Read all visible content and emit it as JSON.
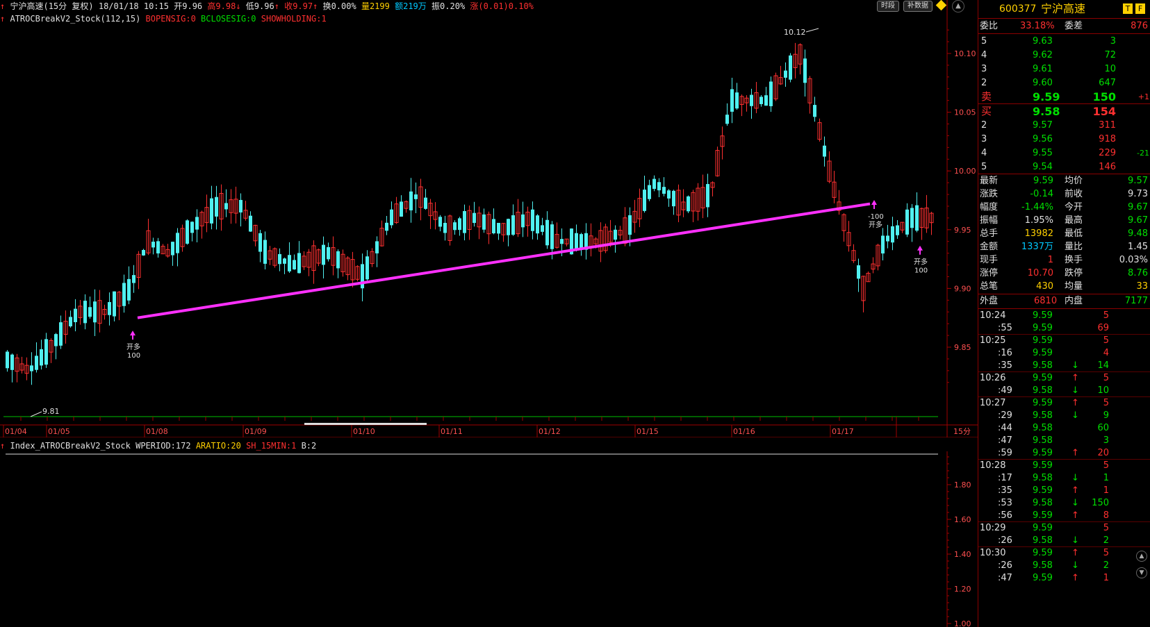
{
  "header": {
    "stock_name": "宁沪高速",
    "period": "(15分 复权)",
    "datetime": "18/01/18 10:15",
    "open_label": "开",
    "open": "9.96",
    "high_label": "高",
    "high": "9.98",
    "low_label": "低",
    "low": "9.96",
    "close_label": "收",
    "close": "9.97",
    "turnover_label": "换",
    "turnover": "0.00%",
    "vol_label": "量",
    "vol": "2199",
    "amount_label": "额",
    "amount": "219万",
    "amp_label": "振",
    "amp": "0.20%",
    "chg_label": "涨",
    "chg": "(0.01)0.10%",
    "btn_time": "时段",
    "btn_supplement": "补数据"
  },
  "indicator": {
    "name": "ATROCBreakV2_Stock(112,15)",
    "p1": "BOPENSIG:0",
    "p2": "BCLOSESIG:0",
    "p3": "SHOWHOLDING:1"
  },
  "sub_indicator": {
    "name": "Index_ATROCBreakV2_Stock",
    "p1": "WPERIOD:172",
    "p2": "ARATIO:20",
    "p3": "SH_15MIN:1",
    "p4": "B:2"
  },
  "chart_data": {
    "type": "candlestick",
    "y_ticks_main": [
      "10.10",
      "10.05",
      "10.00",
      "9.95",
      "9.90",
      "9.85"
    ],
    "y_ticks_sub": [
      "1.80",
      "1.60",
      "1.40",
      "1.20",
      "1.00"
    ],
    "x_ticks": [
      "01/04",
      "01/05",
      "01/08",
      "01/09",
      "01/10",
      "01/11",
      "01/12",
      "01/15",
      "01/16",
      "01/17"
    ],
    "period_label": "15分",
    "high_label": "10.12",
    "low_label": "9.81",
    "signals": [
      {
        "text": "开多",
        "qty": "100"
      },
      {
        "text": "-100",
        "qty": "开多"
      },
      {
        "text": "开多",
        "qty": "100"
      }
    ],
    "colors": {
      "up": "#ff3030",
      "down": "#50f0f0",
      "trend": "#ff30ff"
    }
  },
  "quote": {
    "code": "600377",
    "name": "宁沪高速",
    "ratio_label": "委比",
    "ratio": "33.18%",
    "diff_label": "委差",
    "diff": "876",
    "asks": [
      {
        "level": "5",
        "price": "9.63",
        "vol": "3",
        "chg": ""
      },
      {
        "level": "4",
        "price": "9.62",
        "vol": "72",
        "chg": ""
      },
      {
        "level": "3",
        "price": "9.61",
        "vol": "10",
        "chg": ""
      },
      {
        "level": "2",
        "price": "9.60",
        "vol": "647",
        "chg": ""
      },
      {
        "level": "卖",
        "price": "9.59",
        "vol": "150",
        "chg": "+1"
      }
    ],
    "bids": [
      {
        "level": "买",
        "price": "9.58",
        "vol": "154",
        "chg": ""
      },
      {
        "level": "2",
        "price": "9.57",
        "vol": "311",
        "chg": ""
      },
      {
        "level": "3",
        "price": "9.56",
        "vol": "918",
        "chg": ""
      },
      {
        "level": "4",
        "price": "9.55",
        "vol": "229",
        "chg": "-21"
      },
      {
        "level": "5",
        "price": "9.54",
        "vol": "146",
        "chg": ""
      }
    ],
    "stats": [
      {
        "l1": "最新",
        "v1": "9.59",
        "c1": "g",
        "l2": "均价",
        "v2": "9.57",
        "c2": "g"
      },
      {
        "l1": "涨跌",
        "v1": "-0.14",
        "c1": "g",
        "l2": "前收",
        "v2": "9.73",
        "c2": "w"
      },
      {
        "l1": "幅度",
        "v1": "-1.44%",
        "c1": "g",
        "l2": "今开",
        "v2": "9.67",
        "c2": "g"
      },
      {
        "l1": "振幅",
        "v1": "1.95%",
        "c1": "w",
        "l2": "最高",
        "v2": "9.67",
        "c2": "g"
      },
      {
        "l1": "总手",
        "v1": "13982",
        "c1": "y",
        "l2": "最低",
        "v2": "9.48",
        "c2": "g"
      },
      {
        "l1": "金额",
        "v1": "1337万",
        "c1": "c",
        "l2": "量比",
        "v2": "1.45",
        "c2": "w"
      },
      {
        "l1": "现手",
        "v1": "1",
        "c1": "r",
        "l2": "换手",
        "v2": "0.03%",
        "c2": "w"
      },
      {
        "l1": "涨停",
        "v1": "10.70",
        "c1": "r",
        "l2": "跌停",
        "v2": "8.76",
        "c2": "g"
      },
      {
        "l1": "总笔",
        "v1": "430",
        "c1": "y",
        "l2": "均量",
        "v2": "33",
        "c2": "y"
      }
    ],
    "outer_label": "外盘",
    "outer": "6810",
    "inner_label": "内盘",
    "inner": "7177",
    "ticks": [
      {
        "t": "10:24",
        "p": "9.59",
        "a": "",
        "v": "5",
        "vc": "r",
        "sep": false
      },
      {
        "t": ":55",
        "p": "9.59",
        "a": "",
        "v": "69",
        "vc": "r",
        "sep": false
      },
      {
        "t": "10:25",
        "p": "9.59",
        "a": "",
        "v": "5",
        "vc": "r",
        "sep": true
      },
      {
        "t": ":16",
        "p": "9.59",
        "a": "",
        "v": "4",
        "vc": "r",
        "sep": false
      },
      {
        "t": ":35",
        "p": "9.58",
        "a": "↓",
        "v": "14",
        "vc": "g",
        "sep": false
      },
      {
        "t": "10:26",
        "p": "9.59",
        "a": "↑",
        "v": "5",
        "vc": "r",
        "sep": true
      },
      {
        "t": ":49",
        "p": "9.58",
        "a": "↓",
        "v": "10",
        "vc": "g",
        "sep": false
      },
      {
        "t": "10:27",
        "p": "9.59",
        "a": "↑",
        "v": "5",
        "vc": "r",
        "sep": true
      },
      {
        "t": ":29",
        "p": "9.58",
        "a": "↓",
        "v": "9",
        "vc": "g",
        "sep": false
      },
      {
        "t": ":44",
        "p": "9.58",
        "a": "",
        "v": "60",
        "vc": "g",
        "sep": false
      },
      {
        "t": ":47",
        "p": "9.58",
        "a": "",
        "v": "3",
        "vc": "g",
        "sep": false
      },
      {
        "t": ":59",
        "p": "9.59",
        "a": "↑",
        "v": "20",
        "vc": "r",
        "sep": false
      },
      {
        "t": "10:28",
        "p": "9.59",
        "a": "",
        "v": "5",
        "vc": "r",
        "sep": true
      },
      {
        "t": ":17",
        "p": "9.58",
        "a": "↓",
        "v": "1",
        "vc": "g",
        "sep": false
      },
      {
        "t": ":35",
        "p": "9.59",
        "a": "↑",
        "v": "1",
        "vc": "r",
        "sep": false
      },
      {
        "t": ":53",
        "p": "9.58",
        "a": "↓",
        "v": "150",
        "vc": "g",
        "sep": false
      },
      {
        "t": ":56",
        "p": "9.59",
        "a": "↑",
        "v": "8",
        "vc": "r",
        "sep": false
      },
      {
        "t": "10:29",
        "p": "9.59",
        "a": "",
        "v": "5",
        "vc": "r",
        "sep": true
      },
      {
        "t": ":26",
        "p": "9.58",
        "a": "↓",
        "v": "2",
        "vc": "g",
        "sep": false
      },
      {
        "t": "10:30",
        "p": "9.59",
        "a": "↑",
        "v": "5",
        "vc": "r",
        "sep": true
      },
      {
        "t": ":26",
        "p": "9.58",
        "a": "↓",
        "v": "2",
        "vc": "g",
        "sep": false
      },
      {
        "t": ":47",
        "p": "9.59",
        "a": "↑",
        "v": "1",
        "vc": "r",
        "sep": false
      }
    ]
  }
}
